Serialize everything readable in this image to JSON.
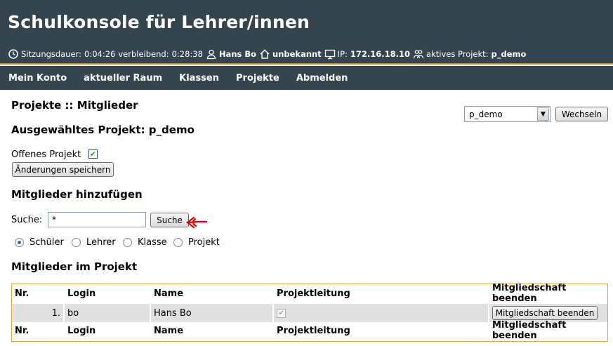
{
  "header": {
    "title": "Schulkonsole für Lehrer/innen",
    "session_label": "Sitzungsdauer:",
    "session_value": "0:04:26",
    "remaining_label": "verbleibend:",
    "remaining_value": "0:28:38",
    "user_name": "Hans Bo",
    "room_value": "unbekannt",
    "ip_label": "IP:",
    "ip_value": "172.16.18.10",
    "project_label": "aktives Projekt:",
    "project_value": "p_demo",
    "icons": [
      "clock-icon",
      "user-icon",
      "house-icon",
      "monitor-icon",
      "group-icon"
    ]
  },
  "nav": {
    "items": [
      {
        "label": "Mein Konto"
      },
      {
        "label": "aktueller Raum"
      },
      {
        "label": "Klassen"
      },
      {
        "label": "Projekte"
      },
      {
        "label": "Abmelden"
      }
    ]
  },
  "main": {
    "breadcrumb": "Projekte :: Mitglieder",
    "selected_project_heading": "Ausgewähltes Projekt: p_demo",
    "project_select_value": "p_demo",
    "switch_button": "Wechseln",
    "open_project_label": "Offenes Projekt",
    "open_project_checked": true,
    "save_button": "Änderungen speichern",
    "add_members_heading": "Mitglieder hinzufügen",
    "search_label": "Suche:",
    "search_value": "*",
    "search_button": "Suche",
    "search_types": [
      {
        "label": "Schüler",
        "checked": true
      },
      {
        "label": "Lehrer",
        "checked": false
      },
      {
        "label": "Klasse",
        "checked": false
      },
      {
        "label": "Projekt",
        "checked": false
      }
    ],
    "members_heading": "Mitglieder im Projekt"
  },
  "table": {
    "columns": [
      "Nr.",
      "Login",
      "Name",
      "Projektleitung",
      "Mitgliedschaft beenden"
    ],
    "rows": [
      {
        "nr": "1.",
        "login": "bo",
        "name": "Hans Bo",
        "leader": true,
        "action": "Mitgliedschaft beenden"
      }
    ]
  },
  "colors": {
    "header_bg": "#34454f",
    "accent": "#d08a1c",
    "annotation_arrow": "#e00000"
  }
}
